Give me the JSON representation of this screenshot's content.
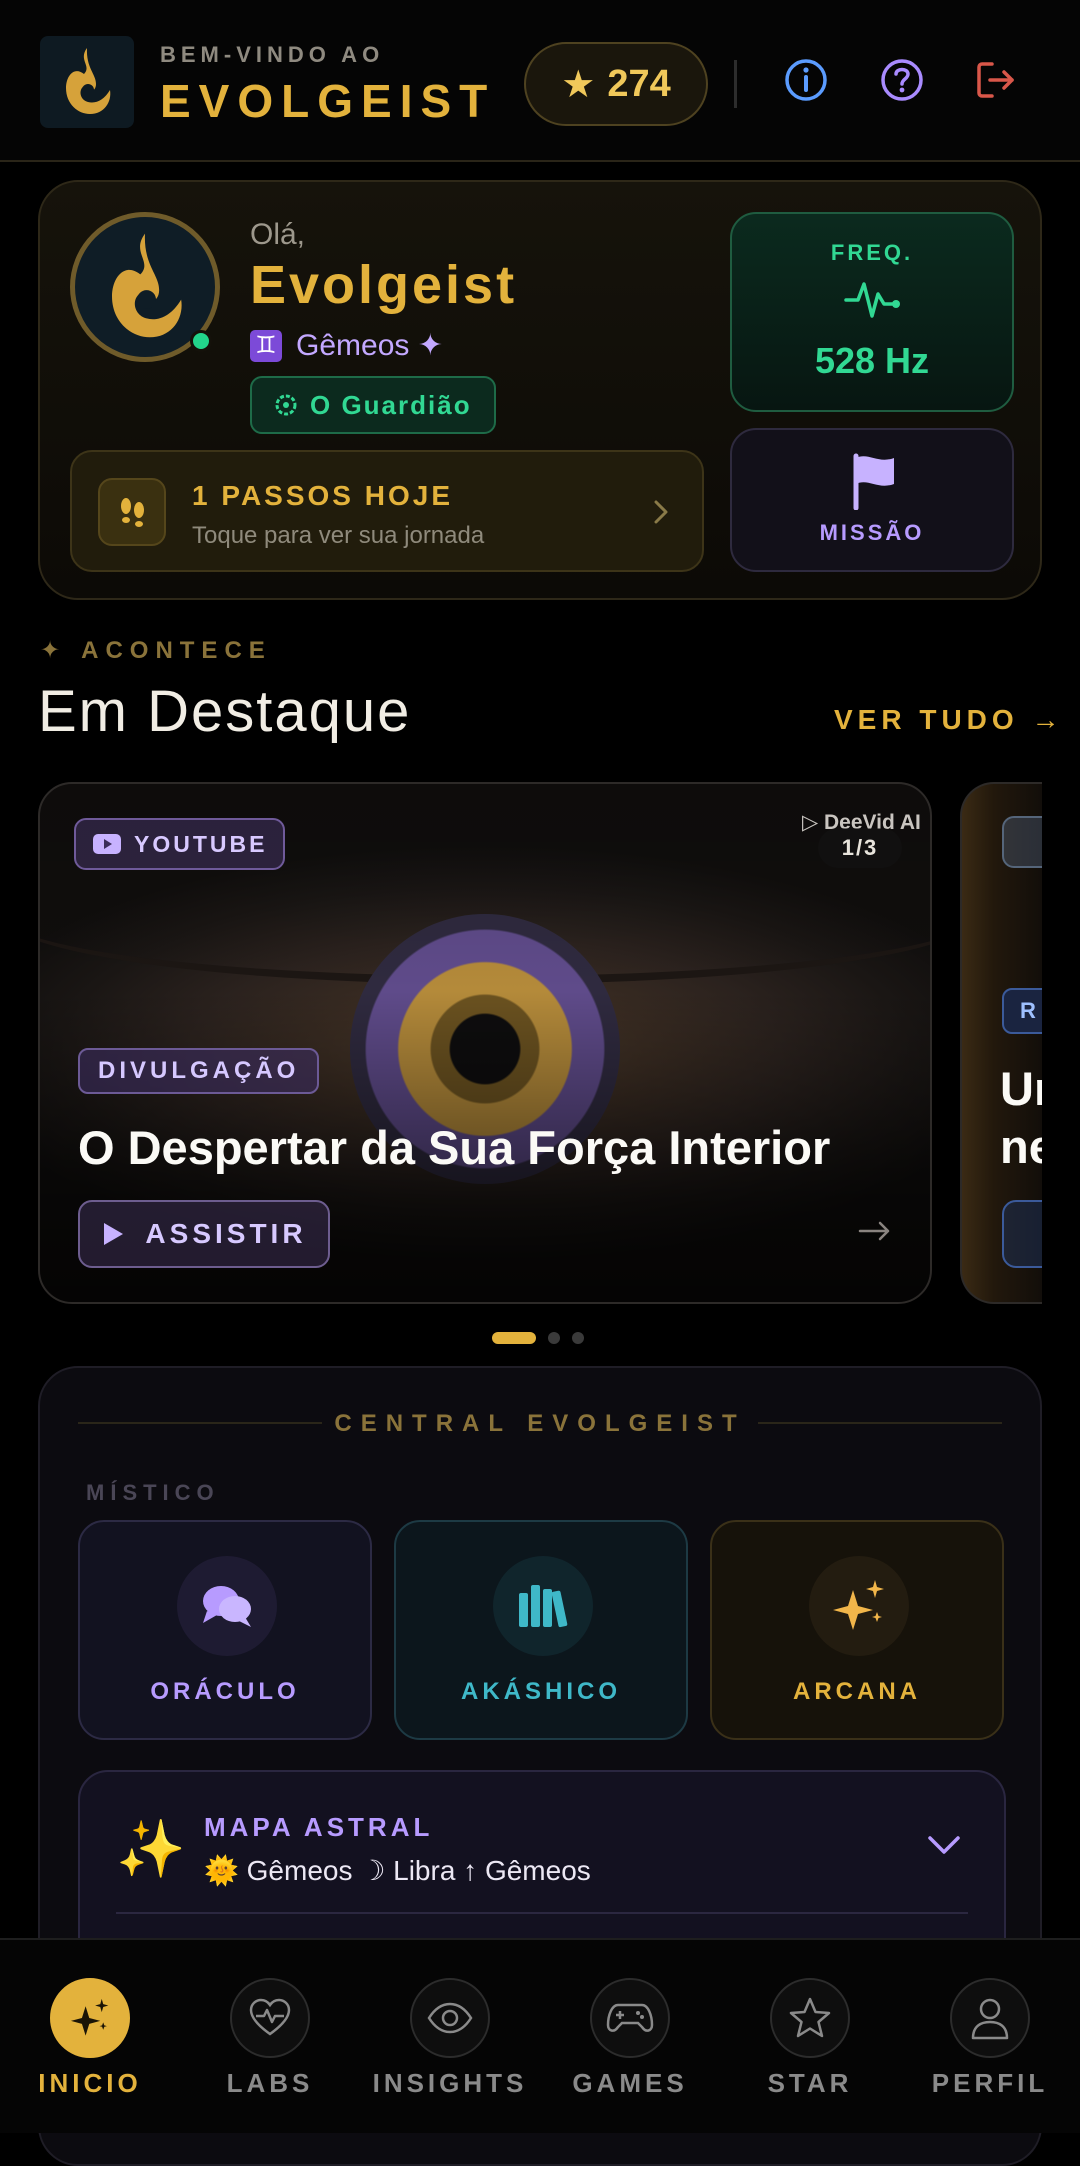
{
  "header": {
    "welcome": "BEM-VINDO AO",
    "brand": "EVOLGEIST",
    "stars": "274"
  },
  "profile": {
    "greeting": "Olá,",
    "name": "Evolgeist",
    "sign_glyph": "♊",
    "sign": "Gêmeos ✦",
    "role": "O Guardião",
    "steps_title": "1 PASSOS HOJE",
    "steps_sub": "Toque para ver sua jornada",
    "freq_label": "FREQ.",
    "freq_value": "528 Hz",
    "mission_label": "MISSÃO"
  },
  "featured": {
    "kicker": "ACONTECE",
    "title": "Em Destaque",
    "see_all": "VER TUDO →",
    "card": {
      "source": "YOUTUBE",
      "watermark": "DeeVid AI",
      "counter": "1/3",
      "category": "DIVULGAÇÃO",
      "title": "O Despertar da Sua Força Interior",
      "action": "ASSISTIR"
    },
    "next_card": {
      "category": "R",
      "title_line1": "Un",
      "title_line2": "ne"
    }
  },
  "central": {
    "title": "CENTRAL EVOLGEIST",
    "section": "MÍSTICO",
    "tiles": [
      "ORÁCULO",
      "AKÁSHICO",
      "ARCANA"
    ],
    "mapa_title": "MAPA ASTRAL",
    "mapa_sub": "🌞 Gêmeos ☽ Libra ↑ Gêmeos",
    "mapa_emoji": "✨"
  },
  "nav": [
    "INICIO",
    "LABS",
    "INSIGHTS",
    "GAMES",
    "STAR",
    "PERFIL"
  ],
  "colors": {
    "gold": "#e3b23c",
    "purple": "#b79bff",
    "green": "#31d893",
    "teal": "#3fb8c8"
  }
}
